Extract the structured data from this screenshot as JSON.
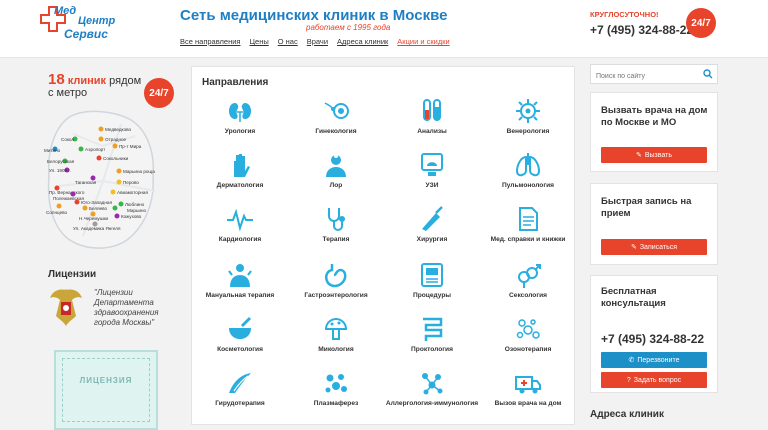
{
  "header": {
    "logo": {
      "line1": "Мед",
      "line2": "Центр",
      "line3": "Сервис"
    },
    "title": "Сеть медицинских клиник в Москве",
    "since": "работаем с 1995 года",
    "nav": [
      "Все направления",
      "Цены",
      "О нас",
      "Врачи",
      "Адреса клиник",
      "Акции и скидки"
    ],
    "round_clock": "КРУГЛОСУТОЧНО!",
    "phone": "+7 (495) 324-88-22",
    "badge": "24/7"
  },
  "left": {
    "clinics_num": "18",
    "clinics_word": "клиник",
    "clinics_rest": "рядом",
    "clinics_line2": "с метро",
    "badge": "24/7",
    "map_stations": [
      "Медведково",
      "Сокол",
      "Отрадное",
      "Митино",
      "Аэропорт",
      "Белорусская",
      "Сокольники",
      "Ул. 1905 г.",
      "Таганская",
      "Марьина роща",
      "Пр. Вернадского",
      "Полежаевская",
      "Перово",
      "Авиамоторная",
      "Юго-Западная",
      "Солнцево",
      "Беляево",
      "Люблино",
      "Кожухово",
      "Ул. Академика Янгеля",
      "Марьино",
      "Н.Черемушки",
      "Пр-т Мира"
    ],
    "licenses_title": "Лицензии",
    "license_text": "\"Лицензии Департамента здравоохранения города Москвы\"",
    "cert_text": "ЛИЦЕНЗИЯ"
  },
  "main": {
    "title": "Направления",
    "directions": [
      {
        "label": "Урология",
        "icon": "kidneys-icon"
      },
      {
        "label": "Гинекология",
        "icon": "sperm-egg-icon"
      },
      {
        "label": "Анализы",
        "icon": "test-tubes-icon"
      },
      {
        "label": "Венерология",
        "icon": "virus-icon"
      },
      {
        "label": "Дерматология",
        "icon": "hand-icon"
      },
      {
        "label": "Лор",
        "icon": "ent-doctor-icon"
      },
      {
        "label": "УЗИ",
        "icon": "ultrasound-icon"
      },
      {
        "label": "Пульмонология",
        "icon": "lungs-icon"
      },
      {
        "label": "Кардиология",
        "icon": "heartbeat-icon"
      },
      {
        "label": "Терапия",
        "icon": "stethoscope-icon"
      },
      {
        "label": "Хирургия",
        "icon": "scalpel-icon"
      },
      {
        "label": "Мед. справки и книжки",
        "icon": "document-icon"
      },
      {
        "label": "Мануальная терапия",
        "icon": "massage-icon"
      },
      {
        "label": "Гастроэнтерология",
        "icon": "stomach-icon"
      },
      {
        "label": "Процедуры",
        "icon": "device-icon"
      },
      {
        "label": "Сексология",
        "icon": "gender-icon"
      },
      {
        "label": "Косметология",
        "icon": "mortar-icon"
      },
      {
        "label": "Микология",
        "icon": "fungus-icon"
      },
      {
        "label": "Проктология",
        "icon": "intestine-icon"
      },
      {
        "label": "Озонотерапия",
        "icon": "bubbles-icon"
      },
      {
        "label": "Гирудотерапия",
        "icon": "leech-icon"
      },
      {
        "label": "Плазмаферез",
        "icon": "cells-icon"
      },
      {
        "label": "Аллергология-иммунология",
        "icon": "molecule-icon"
      },
      {
        "label": "Вызов врача на дом",
        "icon": "ambulance-icon"
      }
    ]
  },
  "right": {
    "search_placeholder": "Поиск по сайту",
    "box1_title": "Вызвать врача на дом по Москве и МО",
    "box1_btn": "Вызвать",
    "box2_title": "Быстрая запись на прием",
    "box2_btn": "Записаться",
    "box3_title": "Бесплатная консультация",
    "box3_phone": "+7 (495) 324-88-22",
    "box3_btn1": "Перезвоните",
    "box3_btn2": "Задать вопрос",
    "addresses_title": "Адреса клиник"
  },
  "colors": {
    "accent_blue": "#1f7fc4",
    "accent_red": "#e8432b",
    "icon_blue": "#29aee0",
    "button_blue": "#1e90c8"
  }
}
